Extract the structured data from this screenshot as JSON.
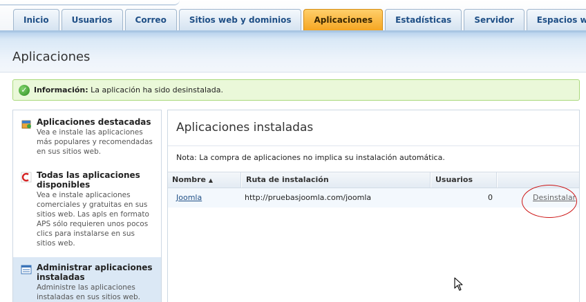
{
  "tabs": [
    {
      "label": "Inicio",
      "active": false
    },
    {
      "label": "Usuarios",
      "active": false
    },
    {
      "label": "Correo",
      "active": false
    },
    {
      "label": "Sitios web y dominios",
      "active": false
    },
    {
      "label": "Aplicaciones",
      "active": true
    },
    {
      "label": "Estadísticas",
      "active": false
    },
    {
      "label": "Servidor",
      "active": false
    },
    {
      "label": "Espacios web",
      "active": false
    }
  ],
  "page": {
    "title": "Aplicaciones"
  },
  "message": {
    "label": "Información:",
    "text": " La aplicación ha sido desinstalada."
  },
  "sidebar": {
    "items": [
      {
        "title": "Aplicaciones destacadas",
        "desc": "Vea e instale las aplicaciones más populares y recomendadas en sus sitios web.",
        "icon": "box-icon"
      },
      {
        "title": "Todas las aplicaciones disponibles",
        "desc": "Vea e instale aplicaciones comerciales y gratuitas en sus sitios web. Las apls en formato APS sólo requieren unos pocos clics para instalarse en sus sitios web.",
        "icon": "swirl-icon"
      },
      {
        "title": "Administrar aplicaciones instaladas",
        "desc": "Administre las aplicaciones instaladas en sus sitios web.",
        "icon": "list-icon"
      }
    ]
  },
  "main": {
    "title": "Aplicaciones instaladas",
    "note": "Nota: La compra de aplicaciones no implica su instalación automática.",
    "columns": {
      "name": "Nombre",
      "sort_arrow": "▲",
      "path": "Ruta de instalación",
      "users": "Usuarios"
    },
    "rows": [
      {
        "name": "Joomla",
        "path": "http://pruebasjoomla.com/joomla",
        "users": "0",
        "action": "Desinstalar"
      }
    ]
  },
  "colors": {
    "active_tab": "#f5a623",
    "accent": "#1f4f86",
    "success_bg": "#eaf8d9",
    "annotation": "#cc1111"
  }
}
